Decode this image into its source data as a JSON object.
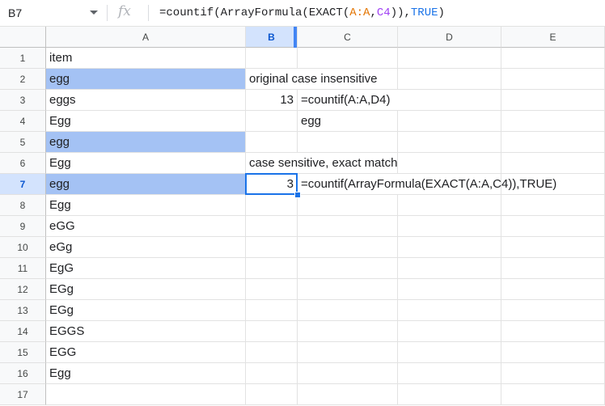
{
  "formula_bar": {
    "name_box": "B7",
    "fx_label": "fx",
    "formula_parts": [
      "=countif(ArrayFormula(EXACT(",
      "A:A",
      ",",
      "C4",
      ")),",
      "TRUE",
      ")"
    ]
  },
  "columns": [
    "A",
    "B",
    "C",
    "D",
    "E"
  ],
  "rows": [
    "1",
    "2",
    "3",
    "4",
    "5",
    "6",
    "7",
    "8",
    "9",
    "10",
    "11",
    "12",
    "13",
    "14",
    "15",
    "16",
    "17"
  ],
  "cells": {
    "A1": "item",
    "A2": "egg",
    "A3": "eggs",
    "A4": "Egg",
    "A5": "egg",
    "A6": "Egg",
    "A7": "egg",
    "A8": "Egg",
    "A9": "eGG",
    "A10": "eGg",
    "A11": "EgG",
    "A12": "EGg",
    "A13": "EGg",
    "A14": "EGGS",
    "A15": "EGG",
    "A16": "Egg",
    "B2": "original case insensitive",
    "B3": "13",
    "C3": "=countif(A:A,D4)",
    "C4": "egg",
    "B6": "case sensitive, exact match",
    "B7": "3",
    "C7": "=countif(ArrayFormula(EXACT(A:A,C4)),TRUE)"
  },
  "highlight_color": "#a4c2f4",
  "selection_color": "#1a73e8"
}
